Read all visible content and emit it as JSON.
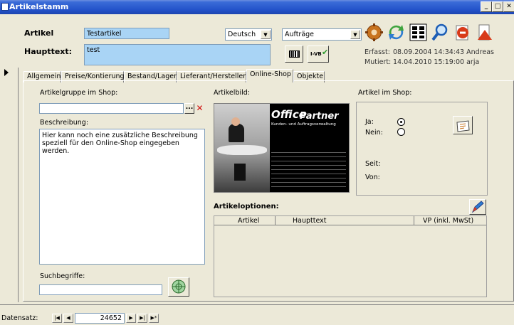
{
  "window": {
    "title": "Artikelstamm"
  },
  "header": {
    "artikel_label": "Artikel",
    "artikel_value": "Testartikel",
    "haupttext_label": "Haupttext:",
    "haupttext_value": "test",
    "language_selected": "Deutsch",
    "context_selected": "Aufträge",
    "barcode_button": "",
    "ivb_label": "I-VB",
    "erfasst_label": "Erfasst:",
    "erfasst_value": "08.09.2004 14:34:43 Andreas",
    "mutiert_label": "Mutiert:",
    "mutiert_value": "14.04.2010 15:19:00 arja"
  },
  "tabs": [
    {
      "label": "Allgemein"
    },
    {
      "label": "Preise/Kontierung"
    },
    {
      "label": "Bestand/Lager"
    },
    {
      "label": "Lieferant/Hersteller"
    },
    {
      "label": "Online-Shop"
    },
    {
      "label": "Objekte"
    }
  ],
  "online_shop": {
    "artikelgruppe_label": "Artikelgruppe im Shop:",
    "artikelgruppe_value": "",
    "ellipsis_label": "...",
    "beschreibung_label": "Beschreibung:",
    "beschreibung_value": "Hier kann noch eine zusätzliche Beschreibung speziell für den Online-Shop eingegeben werden.",
    "suchbegriffe_label": "Suchbegriffe:",
    "suchbegriffe_value": "",
    "artikelbild_label": "Artikelbild:",
    "artikel_im_shop_label": "Artikel im Shop:",
    "ja_label": "Ja:",
    "nein_label": "Nein:",
    "seit_label": "Seit:",
    "von_label": "Von:",
    "artikeloptionen_label": "Artikeloptionen:",
    "optionen_columns": [
      "Artikel",
      "Haupttext",
      "VP (inkl. MwSt)"
    ]
  },
  "image": {
    "brand_top": "Office",
    "brand_bottom": "Partner",
    "tagline": "Kunden- und Auftragsverwaltung"
  },
  "statusbar": {
    "record_label": "Datensatz:",
    "record_value": "24652"
  },
  "colors": {
    "titlebar": "#2352C9",
    "field_blue": "#A9D4F5",
    "window_bg": "#ECE9D8"
  }
}
